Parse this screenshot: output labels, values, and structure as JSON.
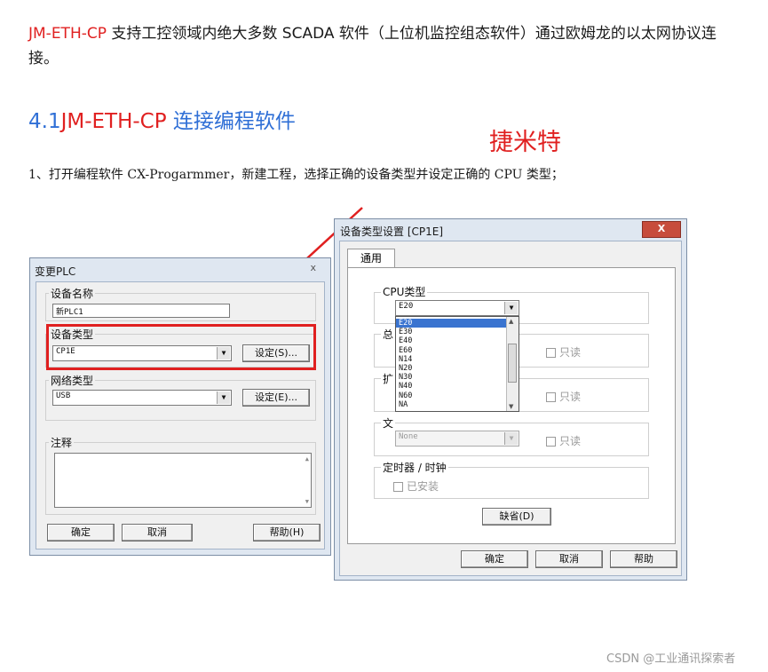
{
  "doc": {
    "intro_red": "JM-ETH-CP",
    "intro_rest": " 支持工控领域内绝大多数 SCADA 软件（上位机监控组态软件）通过欧姆龙的以太网协议连接。",
    "heading_num": "4.1",
    "heading_red": "JM-ETH-CP",
    "heading_rest": " 连接编程软件",
    "stamp": "捷米特",
    "step1": "1、打开编程软件 CX-Progarmmer，新建工程，选择正确的设备类型并设定正确的 CPU 类型；",
    "watermark": "CSDN @工业通讯探索者"
  },
  "plc_dialog": {
    "title": "变更PLC",
    "close": "ⅹ",
    "device_name_label": "设备名称",
    "device_name_value": "新PLC1",
    "device_type_label": "设备类型",
    "device_type_value": "CP1E",
    "settings_btn_1": "设定(S)...",
    "network_type_label": "网络类型",
    "network_type_value": "USB",
    "settings_btn_2": "设定(E)...",
    "notes_label": "注释",
    "ok": "确定",
    "cancel": "取消",
    "help": "帮助(H)"
  },
  "type_dialog": {
    "title": "设备类型设置 [CP1E]",
    "close": "X",
    "tab_general": "通用",
    "cpu_type_label": "CPU类型",
    "cpu_type_value": "E20",
    "cpu_options": [
      "E20",
      "E30",
      "E40",
      "E60",
      "N14",
      "N20",
      "N30",
      "N40",
      "N60",
      "NA"
    ],
    "group2_label": "总",
    "group3_label": "扩",
    "group4_label": "文",
    "readonly": "只读",
    "none_value": "None",
    "timer_clock_label": "定时器 / 时钟",
    "installed": "已安装",
    "default_btn": "缺省(D)",
    "ok": "确定",
    "cancel": "取消",
    "help": "帮助"
  },
  "colors": {
    "highlight": "#e02020",
    "heading_blue": "#2f6fd6"
  }
}
